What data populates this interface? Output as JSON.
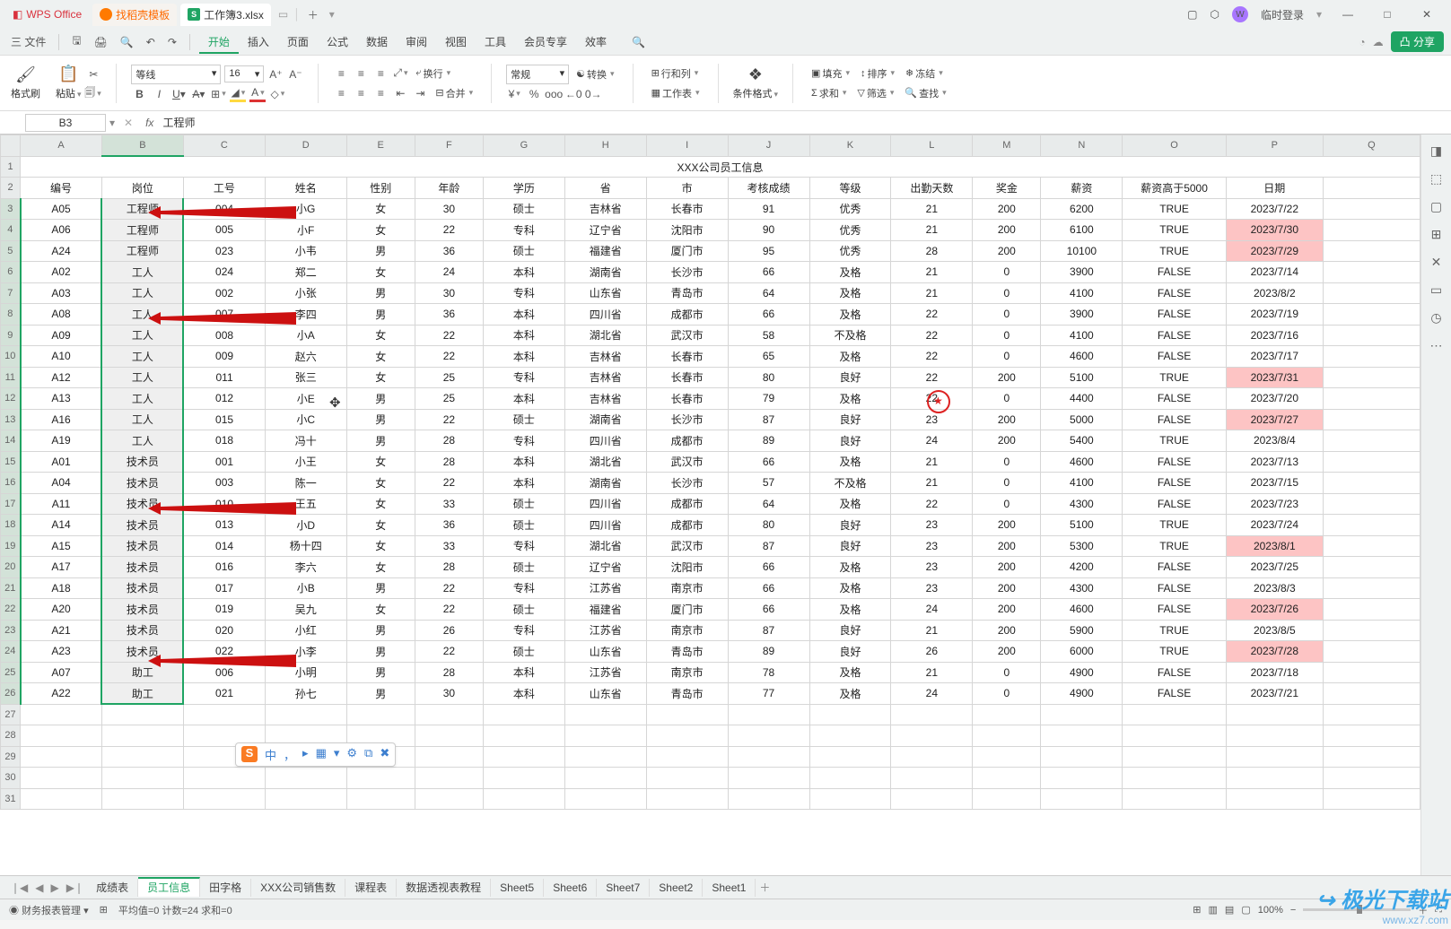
{
  "titlebar": {
    "wps": "WPS Office",
    "template_tab": "找稻壳模板",
    "doc_tab": "工作簿3.xlsx",
    "login": "临时登录"
  },
  "menubar": {
    "file": "三 文件",
    "tabs": [
      "开始",
      "插入",
      "页面",
      "公式",
      "数据",
      "审阅",
      "视图",
      "工具",
      "会员专享",
      "效率"
    ],
    "share": "凸 分享"
  },
  "ribbon": {
    "format_painter": "格式刷",
    "paste": "粘贴",
    "font_name": "等线",
    "font_size": "16",
    "bold": "B",
    "italic": "I",
    "underline": "U",
    "strike": "S",
    "wrap": "换行",
    "merge": "合并",
    "numfmt": "常规",
    "convert": "转换",
    "rowcol": "行和列",
    "worksheet": "工作表",
    "cond_fmt": "条件格式",
    "fill": "填充",
    "sort": "排序",
    "freeze": "冻结",
    "sum": "求和",
    "filter": "筛选",
    "find": "查找"
  },
  "formula": {
    "ref": "B3",
    "fx": "fx",
    "val": "工程师"
  },
  "cols": [
    "A",
    "B",
    "C",
    "D",
    "E",
    "F",
    "G",
    "H",
    "I",
    "J",
    "K",
    "L",
    "M",
    "N",
    "O",
    "P",
    "Q"
  ],
  "title_row": "XXX公司员工信息",
  "headers": [
    "编号",
    "岗位",
    "工号",
    "姓名",
    "性别",
    "年龄",
    "学历",
    "省",
    "市",
    "考核成绩",
    "等级",
    "出勤天数",
    "奖金",
    "薪资",
    "薪资高于5000",
    "日期"
  ],
  "rows": [
    {
      "r": 3,
      "c": [
        "A05",
        "工程师",
        "004",
        "小G",
        "女",
        "30",
        "硕士",
        "吉林省",
        "长春市",
        "91",
        "优秀",
        "21",
        "200",
        "6200",
        "TRUE",
        "2023/7/22"
      ],
      "hl": []
    },
    {
      "r": 4,
      "c": [
        "A06",
        "工程师",
        "005",
        "小F",
        "女",
        "22",
        "专科",
        "辽宁省",
        "沈阳市",
        "90",
        "优秀",
        "21",
        "200",
        "6100",
        "TRUE",
        "2023/7/30"
      ],
      "hl": [
        15
      ]
    },
    {
      "r": 5,
      "c": [
        "A24",
        "工程师",
        "023",
        "小韦",
        "男",
        "36",
        "硕士",
        "福建省",
        "厦门市",
        "95",
        "优秀",
        "28",
        "200",
        "10100",
        "TRUE",
        "2023/7/29"
      ],
      "hl": [
        15
      ]
    },
    {
      "r": 6,
      "c": [
        "A02",
        "工人",
        "024",
        "郑二",
        "女",
        "24",
        "本科",
        "湖南省",
        "长沙市",
        "66",
        "及格",
        "21",
        "0",
        "3900",
        "FALSE",
        "2023/7/14"
      ],
      "hl": []
    },
    {
      "r": 7,
      "c": [
        "A03",
        "工人",
        "002",
        "小张",
        "男",
        "30",
        "专科",
        "山东省",
        "青岛市",
        "64",
        "及格",
        "21",
        "0",
        "4100",
        "FALSE",
        "2023/8/2"
      ],
      "hl": []
    },
    {
      "r": 8,
      "c": [
        "A08",
        "工人",
        "007",
        "李四",
        "男",
        "36",
        "本科",
        "四川省",
        "成都市",
        "66",
        "及格",
        "22",
        "0",
        "3900",
        "FALSE",
        "2023/7/19"
      ],
      "hl": []
    },
    {
      "r": 9,
      "c": [
        "A09",
        "工人",
        "008",
        "小A",
        "女",
        "22",
        "本科",
        "湖北省",
        "武汉市",
        "58",
        "不及格",
        "22",
        "0",
        "4100",
        "FALSE",
        "2023/7/16"
      ],
      "hl": []
    },
    {
      "r": 10,
      "c": [
        "A10",
        "工人",
        "009",
        "赵六",
        "女",
        "22",
        "本科",
        "吉林省",
        "长春市",
        "65",
        "及格",
        "22",
        "0",
        "4600",
        "FALSE",
        "2023/7/17"
      ],
      "hl": []
    },
    {
      "r": 11,
      "c": [
        "A12",
        "工人",
        "011",
        "张三",
        "女",
        "25",
        "专科",
        "吉林省",
        "长春市",
        "80",
        "良好",
        "22",
        "200",
        "5100",
        "TRUE",
        "2023/7/31"
      ],
      "hl": [
        15
      ]
    },
    {
      "r": 12,
      "c": [
        "A13",
        "工人",
        "012",
        "小E",
        "男",
        "25",
        "本科",
        "吉林省",
        "长春市",
        "79",
        "及格",
        "22",
        "0",
        "4400",
        "FALSE",
        "2023/7/20"
      ],
      "hl": []
    },
    {
      "r": 13,
      "c": [
        "A16",
        "工人",
        "015",
        "小C",
        "男",
        "22",
        "硕士",
        "湖南省",
        "长沙市",
        "87",
        "良好",
        "23",
        "200",
        "5000",
        "FALSE",
        "2023/7/27"
      ],
      "hl": [
        15
      ]
    },
    {
      "r": 14,
      "c": [
        "A19",
        "工人",
        "018",
        "冯十",
        "男",
        "28",
        "专科",
        "四川省",
        "成都市",
        "89",
        "良好",
        "24",
        "200",
        "5400",
        "TRUE",
        "2023/8/4"
      ],
      "hl": []
    },
    {
      "r": 15,
      "c": [
        "A01",
        "技术员",
        "001",
        "小王",
        "女",
        "28",
        "本科",
        "湖北省",
        "武汉市",
        "66",
        "及格",
        "21",
        "0",
        "4600",
        "FALSE",
        "2023/7/13"
      ],
      "hl": []
    },
    {
      "r": 16,
      "c": [
        "A04",
        "技术员",
        "003",
        "陈一",
        "女",
        "22",
        "本科",
        "湖南省",
        "长沙市",
        "57",
        "不及格",
        "21",
        "0",
        "4100",
        "FALSE",
        "2023/7/15"
      ],
      "hl": []
    },
    {
      "r": 17,
      "c": [
        "A11",
        "技术员",
        "010",
        "王五",
        "女",
        "33",
        "硕士",
        "四川省",
        "成都市",
        "64",
        "及格",
        "22",
        "0",
        "4300",
        "FALSE",
        "2023/7/23"
      ],
      "hl": []
    },
    {
      "r": 18,
      "c": [
        "A14",
        "技术员",
        "013",
        "小D",
        "女",
        "36",
        "硕士",
        "四川省",
        "成都市",
        "80",
        "良好",
        "23",
        "200",
        "5100",
        "TRUE",
        "2023/7/24"
      ],
      "hl": []
    },
    {
      "r": 19,
      "c": [
        "A15",
        "技术员",
        "014",
        "杨十四",
        "女",
        "33",
        "专科",
        "湖北省",
        "武汉市",
        "87",
        "良好",
        "23",
        "200",
        "5300",
        "TRUE",
        "2023/8/1"
      ],
      "hl": [
        15
      ]
    },
    {
      "r": 20,
      "c": [
        "A17",
        "技术员",
        "016",
        "李六",
        "女",
        "28",
        "硕士",
        "辽宁省",
        "沈阳市",
        "66",
        "及格",
        "23",
        "200",
        "4200",
        "FALSE",
        "2023/7/25"
      ],
      "hl": []
    },
    {
      "r": 21,
      "c": [
        "A18",
        "技术员",
        "017",
        "小B",
        "男",
        "22",
        "专科",
        "江苏省",
        "南京市",
        "66",
        "及格",
        "23",
        "200",
        "4300",
        "FALSE",
        "2023/8/3"
      ],
      "hl": []
    },
    {
      "r": 22,
      "c": [
        "A20",
        "技术员",
        "019",
        "吴九",
        "女",
        "22",
        "硕士",
        "福建省",
        "厦门市",
        "66",
        "及格",
        "24",
        "200",
        "4600",
        "FALSE",
        "2023/7/26"
      ],
      "hl": [
        15
      ]
    },
    {
      "r": 23,
      "c": [
        "A21",
        "技术员",
        "020",
        "小红",
        "男",
        "26",
        "专科",
        "江苏省",
        "南京市",
        "87",
        "良好",
        "21",
        "200",
        "5900",
        "TRUE",
        "2023/8/5"
      ],
      "hl": []
    },
    {
      "r": 24,
      "c": [
        "A23",
        "技术员",
        "022",
        "小李",
        "男",
        "22",
        "硕士",
        "山东省",
        "青岛市",
        "89",
        "良好",
        "26",
        "200",
        "6000",
        "TRUE",
        "2023/7/28"
      ],
      "hl": [
        15
      ]
    },
    {
      "r": 25,
      "c": [
        "A07",
        "助工",
        "006",
        "小明",
        "男",
        "28",
        "本科",
        "江苏省",
        "南京市",
        "78",
        "及格",
        "21",
        "0",
        "4900",
        "FALSE",
        "2023/7/18"
      ],
      "hl": []
    },
    {
      "r": 26,
      "c": [
        "A22",
        "助工",
        "021",
        "孙七",
        "男",
        "30",
        "本科",
        "山东省",
        "青岛市",
        "77",
        "及格",
        "24",
        "0",
        "4900",
        "FALSE",
        "2023/7/21"
      ],
      "hl": []
    }
  ],
  "sheet_tabs": [
    "成绩表",
    "员工信息",
    "田字格",
    "XXX公司销售数",
    "课程表",
    "数据透视表教程",
    "Sheet5",
    "Sheet6",
    "Sheet7",
    "Sheet2",
    "Sheet1"
  ],
  "statusbar": {
    "mode": "财务报表管理",
    "stats": "平均值=0  计数=24  求和=0",
    "zoom": "100%"
  },
  "ime": [
    "中",
    "，",
    "▸",
    "▦",
    "▾",
    "⚙",
    "⧉",
    "✖"
  ],
  "watermark": {
    "name": "极光下载站",
    "url": "www.xz7.com"
  }
}
